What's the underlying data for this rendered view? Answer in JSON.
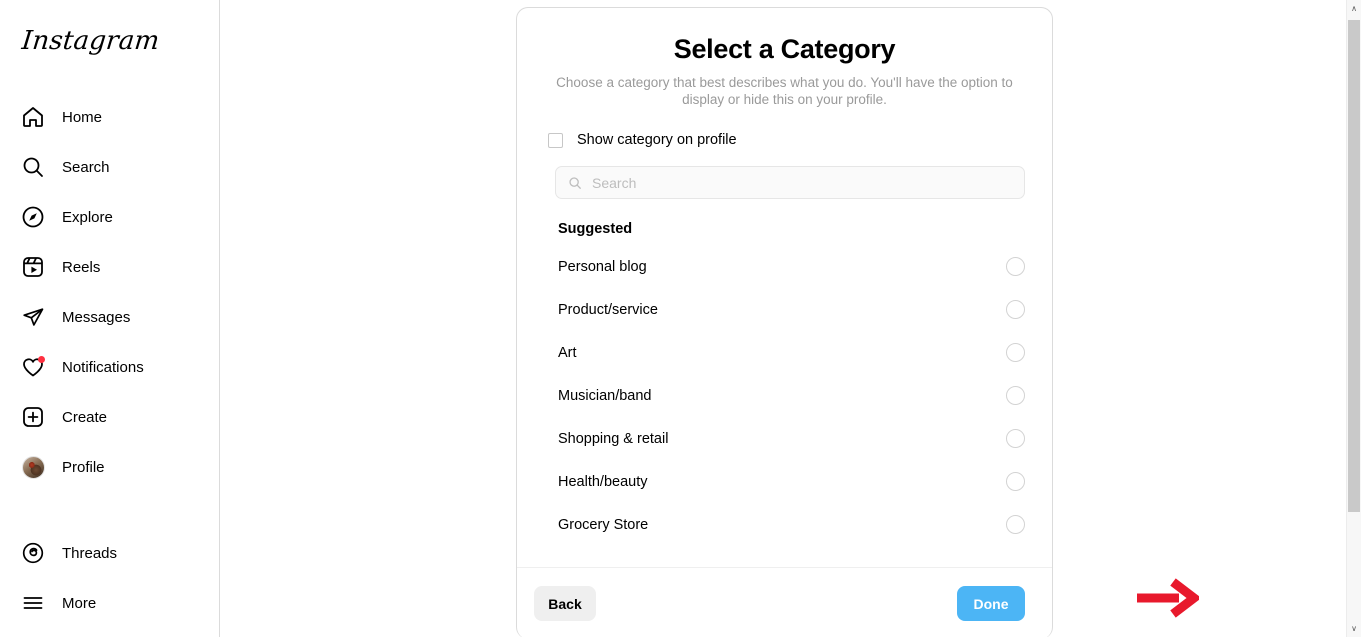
{
  "brand": {
    "name": "Instagram"
  },
  "sidebar": {
    "items": [
      {
        "label": "Home",
        "icon": "home-icon"
      },
      {
        "label": "Search",
        "icon": "search-icon"
      },
      {
        "label": "Explore",
        "icon": "compass-icon"
      },
      {
        "label": "Reels",
        "icon": "reels-icon"
      },
      {
        "label": "Messages",
        "icon": "messenger-icon"
      },
      {
        "label": "Notifications",
        "icon": "heart-icon"
      },
      {
        "label": "Create",
        "icon": "plus-square-icon"
      },
      {
        "label": "Profile",
        "icon": "avatar-icon"
      },
      {
        "label": "Threads",
        "icon": "threads-icon"
      },
      {
        "label": "More",
        "icon": "hamburger-menu-icon"
      }
    ]
  },
  "modal": {
    "title": "Select a Category",
    "subtitle": "Choose a category that best describes what you do. You'll have the option to display or hide this on your profile.",
    "show_category_checkbox": {
      "label": "Show category on profile",
      "checked": false
    },
    "search": {
      "placeholder": "Search",
      "value": ""
    },
    "section_label": "Suggested",
    "categories": [
      {
        "label": "Personal blog",
        "selected": false
      },
      {
        "label": "Product/service",
        "selected": false
      },
      {
        "label": "Art",
        "selected": false
      },
      {
        "label": "Musician/band",
        "selected": false
      },
      {
        "label": "Shopping & retail",
        "selected": false
      },
      {
        "label": "Health/beauty",
        "selected": false
      },
      {
        "label": "Grocery Store",
        "selected": false
      }
    ],
    "footer": {
      "back_label": "Back",
      "done_label": "Done"
    }
  },
  "annotation": {
    "arrow_color": "#e8192c",
    "points_to": "Done"
  },
  "colors": {
    "accent_blue": "#4cb5f5",
    "button_gray": "#efefef",
    "notification_red": "#ff3040",
    "border_gray": "#dbdbdb"
  },
  "scrollbar": {
    "up_arrow": "∧",
    "down_arrow": "∨"
  }
}
